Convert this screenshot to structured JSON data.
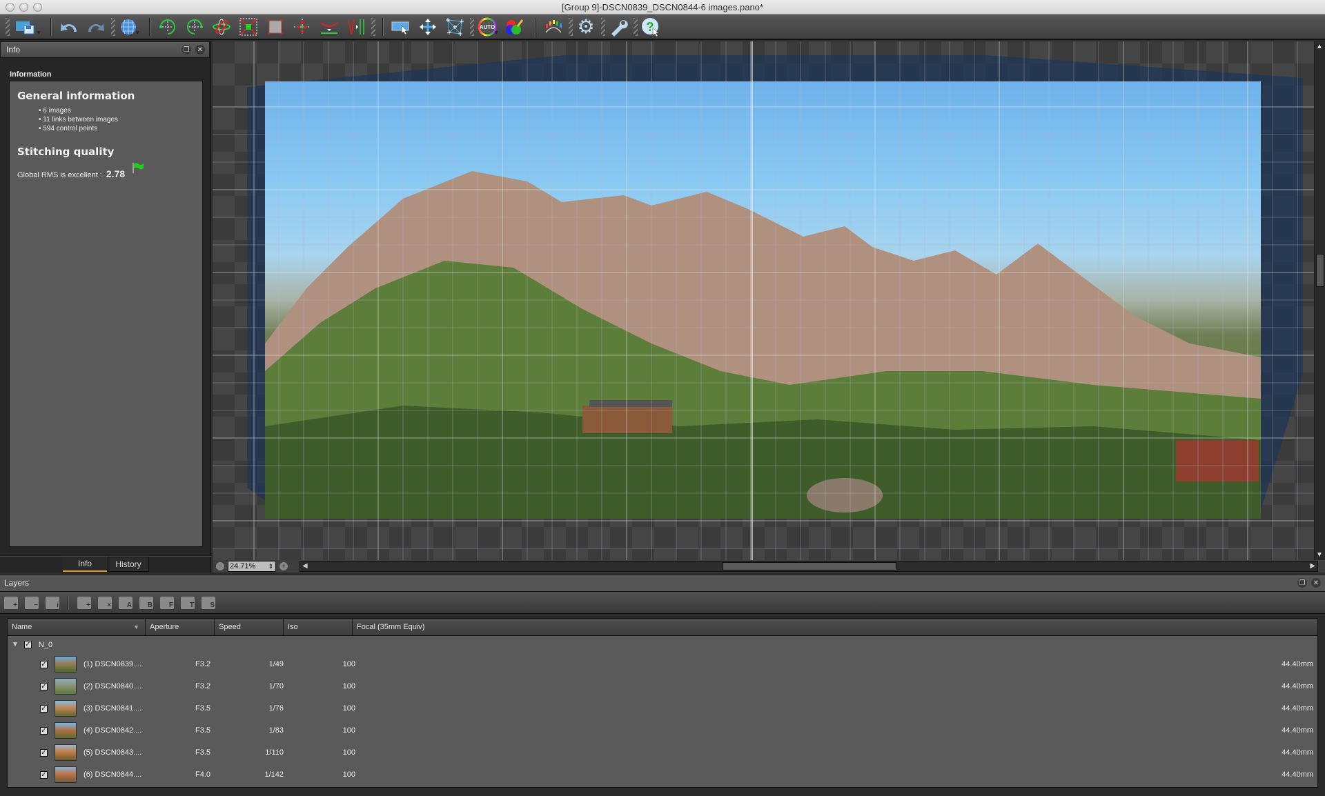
{
  "window": {
    "title": "[Group 9]-DSCN0839_DSCN0844-6 images.pano*"
  },
  "toolbar": {
    "buttons": [
      {
        "name": "save-project-icon",
        "glyph": "💾"
      },
      {
        "name": "undo-icon",
        "glyph": "↶"
      },
      {
        "name": "redo-icon",
        "glyph": "↷"
      },
      {
        "name": "projection-globe-icon",
        "glyph": "🌐"
      },
      {
        "name": "rotate-left-icon",
        "glyph": "⟲"
      },
      {
        "name": "rotate-right-icon",
        "glyph": "⟳"
      },
      {
        "name": "rotate-3d-icon",
        "glyph": "⊗"
      },
      {
        "name": "crop-fit-icon",
        "glyph": "⤧"
      },
      {
        "name": "crop-icon",
        "glyph": "▣"
      },
      {
        "name": "set-center-icon",
        "glyph": "✛"
      },
      {
        "name": "horizon-icon",
        "glyph": "⌣"
      },
      {
        "name": "vertical-lines-icon",
        "glyph": "⫴"
      },
      {
        "name": "select-image-icon",
        "glyph": "▭"
      },
      {
        "name": "move-icon",
        "glyph": "✥"
      },
      {
        "name": "control-points-icon",
        "glyph": "⌗"
      },
      {
        "name": "auto-color-icon",
        "glyph": "AUTO"
      },
      {
        "name": "color-correction-icon",
        "glyph": "●"
      },
      {
        "name": "exposure-icon",
        "glyph": "◠"
      },
      {
        "name": "settings-gear-icon",
        "glyph": "⚙"
      },
      {
        "name": "tools-wrench-icon",
        "glyph": "🔧"
      },
      {
        "name": "help-icon",
        "glyph": "?"
      }
    ]
  },
  "info_panel": {
    "title": "Info",
    "section_label": "Information",
    "general_heading": "General information",
    "general_items": [
      "6 images",
      "11 links between images",
      "594 control points"
    ],
    "quality_heading": "Stitching quality",
    "rms_label": "Global RMS is excellent :",
    "rms_value": "2.78",
    "flag_color": "#22cc22",
    "tabs": [
      {
        "label": "Info",
        "active": true
      },
      {
        "label": "History",
        "active": false
      }
    ]
  },
  "viewer": {
    "zoom_value": "24.71%",
    "zoom_minus": "−",
    "zoom_plus": "+"
  },
  "layers_panel": {
    "title": "Layers",
    "tools": [
      {
        "name": "add-image-icon",
        "label": "+"
      },
      {
        "name": "remove-image-icon",
        "label": "−"
      },
      {
        "name": "image-info-icon",
        "label": "i"
      },
      {
        "name": "add-group-icon",
        "label": "+"
      },
      {
        "name": "delete-group-icon",
        "label": "×"
      },
      {
        "name": "group-a-icon",
        "label": "A"
      },
      {
        "name": "group-b-icon",
        "label": "B"
      },
      {
        "name": "group-f-icon",
        "label": "F"
      },
      {
        "name": "group-t-icon",
        "label": "T"
      },
      {
        "name": "group-s-icon",
        "label": "S"
      }
    ],
    "columns": [
      "Name",
      "Aperture",
      "Speed",
      "Iso",
      "Focal (35mm Equiv)"
    ],
    "group": {
      "name": "N_0",
      "checked": true,
      "expanded": true
    },
    "rows": [
      {
        "name": "(1) DSCN0839....",
        "aperture": "F3.2",
        "speed": "1/49",
        "iso": "100",
        "focal": "44.40mm",
        "checked": true
      },
      {
        "name": "(2) DSCN0840....",
        "aperture": "F3.2",
        "speed": "1/70",
        "iso": "100",
        "focal": "44.40mm",
        "checked": true
      },
      {
        "name": "(3) DSCN0841....",
        "aperture": "F3.5",
        "speed": "1/76",
        "iso": "100",
        "focal": "44.40mm",
        "checked": true
      },
      {
        "name": "(4) DSCN0842....",
        "aperture": "F3.5",
        "speed": "1/83",
        "iso": "100",
        "focal": "44.40mm",
        "checked": true
      },
      {
        "name": "(5) DSCN0843....",
        "aperture": "F3.5",
        "speed": "1/110",
        "iso": "100",
        "focal": "44.40mm",
        "checked": true
      },
      {
        "name": "(6) DSCN0844....",
        "aperture": "F4.0",
        "speed": "1/142",
        "iso": "100",
        "focal": "44.40mm",
        "checked": true
      }
    ]
  }
}
